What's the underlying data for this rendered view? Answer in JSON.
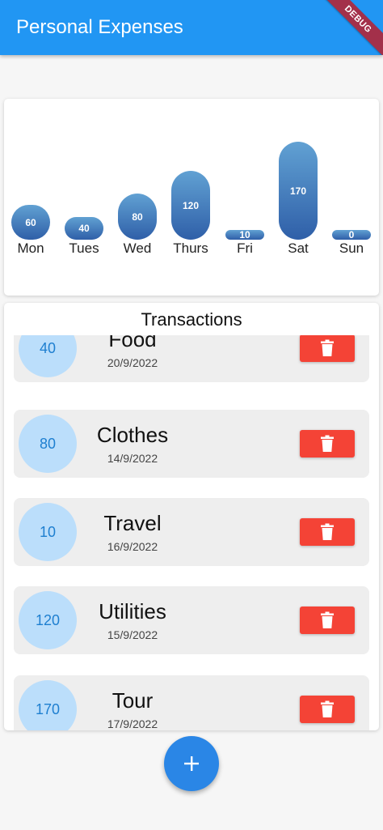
{
  "app_bar": {
    "title": "Personal Expenses",
    "debug_label": "DEBUG"
  },
  "colors": {
    "primary": "#2196f3",
    "bar_gradient_top": "#61a1d3",
    "bar_gradient_bottom": "#2f5fa8",
    "amount_circle": "#bbdefb",
    "delete": "#f44336",
    "fab": "#2a86e6"
  },
  "chart_data": {
    "type": "bar",
    "categories": [
      "Mon",
      "Tues",
      "Wed",
      "Thurs",
      "Fri",
      "Sat",
      "Sun"
    ],
    "values": [
      60,
      40,
      80,
      120,
      10,
      170,
      0
    ],
    "grid": false
  },
  "transactions_title": "Transactions",
  "transactions": [
    {
      "amount": "40",
      "title": "Food",
      "date": "20/9/2022",
      "delete_icon": "trash-icon"
    },
    {
      "amount": "80",
      "title": "Clothes",
      "date": "14/9/2022",
      "delete_icon": "trash-icon"
    },
    {
      "amount": "10",
      "title": "Travel",
      "date": "16/9/2022",
      "delete_icon": "trash-icon"
    },
    {
      "amount": "120",
      "title": "Utilities",
      "date": "15/9/2022",
      "delete_icon": "trash-icon"
    },
    {
      "amount": "170",
      "title": "Tour",
      "date": "17/9/2022",
      "delete_icon": "trash-icon"
    }
  ],
  "fab": {
    "icon": "plus-icon"
  }
}
